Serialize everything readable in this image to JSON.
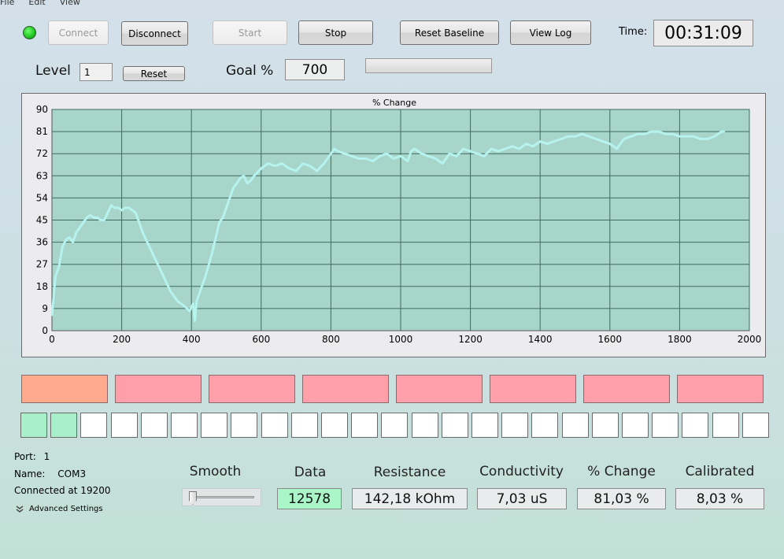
{
  "menu": [
    "File",
    "Edit",
    "View"
  ],
  "toolbar": {
    "connect": "Connect",
    "disconnect": "Disconnect",
    "start": "Start",
    "stop": "Stop",
    "reset_baseline": "Reset Baseline",
    "view_log": "View Log",
    "time_label": "Time:",
    "time_value": "00:31:09"
  },
  "level": {
    "label": "Level",
    "value": "1",
    "reset": "Reset"
  },
  "goal": {
    "label": "Goal %",
    "value": "700"
  },
  "progress": 0,
  "chart_data": {
    "type": "line",
    "title": "% Change",
    "xlabel": "",
    "ylabel": "",
    "xlim": [
      0,
      2000
    ],
    "ylim": [
      0,
      90
    ],
    "xticks": [
      0,
      200,
      400,
      600,
      800,
      1000,
      1200,
      1400,
      1600,
      1800,
      2000
    ],
    "yticks": [
      0,
      9,
      18,
      27,
      36,
      45,
      54,
      63,
      72,
      81,
      90
    ],
    "grid": true,
    "colors": {
      "background": "#a8d5ca",
      "line": "#b6f3ee",
      "grid": "#3f6b5e"
    },
    "series": [
      {
        "x": [
          0,
          10,
          20,
          30,
          40,
          50,
          60,
          70,
          80,
          90,
          100,
          110,
          120,
          130,
          140,
          150,
          160,
          170,
          180,
          190,
          200,
          210,
          220,
          230,
          240,
          250,
          260,
          280,
          300,
          320,
          340,
          360,
          380,
          395,
          405,
          410,
          415,
          420,
          430,
          440,
          450,
          460,
          470,
          480,
          490,
          500,
          510,
          520,
          530,
          540,
          550,
          560,
          570,
          580,
          600,
          620,
          640,
          660,
          680,
          700,
          720,
          740,
          760,
          780,
          800,
          810,
          820,
          840,
          860,
          880,
          900,
          920,
          940,
          960,
          980,
          1000,
          1020,
          1030,
          1040,
          1060,
          1080,
          1100,
          1120,
          1140,
          1160,
          1180,
          1200,
          1220,
          1240,
          1260,
          1280,
          1300,
          1320,
          1340,
          1360,
          1380,
          1400,
          1420,
          1440,
          1460,
          1480,
          1500,
          1520,
          1540,
          1560,
          1580,
          1600,
          1620,
          1640,
          1660,
          1680,
          1700,
          1720,
          1740,
          1760,
          1780,
          1800,
          1820,
          1840,
          1860,
          1880,
          1900,
          1920,
          1930
        ],
        "values": [
          6,
          22,
          26,
          34,
          37,
          38,
          36,
          40,
          42,
          44,
          46,
          47,
          46,
          46,
          45,
          45,
          48,
          51,
          50,
          50,
          49,
          50,
          50,
          49,
          48,
          44,
          40,
          34,
          28,
          22,
          16,
          12,
          10,
          8,
          11,
          4,
          12,
          14,
          18,
          22,
          27,
          32,
          38,
          44,
          46,
          50,
          54,
          58,
          60,
          62,
          63,
          60,
          61,
          63,
          66,
          68,
          67,
          68,
          66,
          65,
          68,
          67,
          65,
          68,
          72,
          74,
          73,
          72,
          71,
          70,
          70,
          69,
          71,
          72,
          70,
          71,
          69,
          73,
          74,
          72,
          71,
          70,
          68,
          72,
          71,
          74,
          73,
          72,
          71,
          74,
          73,
          74,
          75,
          74,
          76,
          75,
          77,
          76,
          77,
          78,
          79,
          79,
          80,
          79,
          78,
          77,
          76,
          74,
          78,
          79,
          80,
          80,
          81,
          81,
          80,
          80,
          79,
          79,
          79,
          78,
          78,
          79,
          81,
          81
        ]
      }
    ]
  },
  "progress_blocks": [
    {
      "color": "#ffaa8e"
    },
    {
      "color": "#ff9faa"
    },
    {
      "color": "#ff9faa"
    },
    {
      "color": "#ff9faa"
    },
    {
      "color": "#ff9faa"
    },
    {
      "color": "#ff9faa"
    },
    {
      "color": "#ff9faa"
    },
    {
      "color": "#ff9faa"
    }
  ],
  "level_cells": {
    "total": 25,
    "filled": 2,
    "fill_color": "#a8f0c9"
  },
  "status": {
    "port_label": "Port:",
    "port_value": "1",
    "name_label": "Name:",
    "name_value": "COM3",
    "connected": "Connected at 19200",
    "advanced": "Advanced Settings"
  },
  "smooth": {
    "label": "Smooth",
    "level": 0
  },
  "readouts": {
    "data": {
      "label": "Data",
      "value": "12578"
    },
    "resistance": {
      "label": "Resistance",
      "value": "142,18 kOhm"
    },
    "conductivity": {
      "label": "Conductivity",
      "value": "7,03 uS"
    },
    "change": {
      "label": "% Change",
      "value": "81,03 %"
    },
    "calibrated": {
      "label": "Calibrated",
      "value": "8,03 %"
    }
  }
}
